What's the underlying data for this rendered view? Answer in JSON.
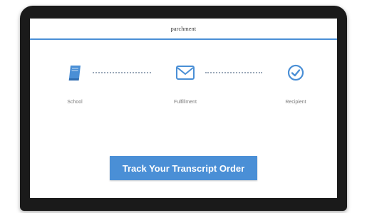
{
  "header": {
    "brand": "parchment"
  },
  "steps": [
    {
      "label": "School",
      "icon": "book-icon"
    },
    {
      "label": "Fulfillment",
      "icon": "envelope-icon"
    },
    {
      "label": "Recipient",
      "icon": "check-circle-icon"
    }
  ],
  "cta": {
    "label": "Track Your Transcript Order"
  },
  "colors": {
    "accent": "#4a8fd6",
    "icon": "#4a8fd6",
    "label_text": "#7a7a7a",
    "laptop_frame": "#1a1a1a"
  }
}
